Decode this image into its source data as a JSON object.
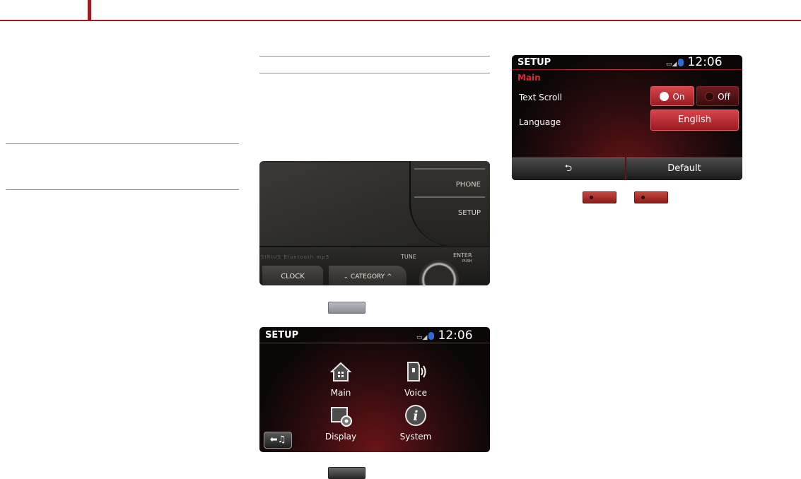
{
  "head_unit": {
    "phone_label": "PHONE",
    "setup_label": "SETUP",
    "tune_label": "TUNE",
    "enter_label": "ENTER",
    "push_label": "PUSH",
    "clock_label": "CLOCK",
    "category_label": "⌄ CATEGORY ^",
    "logos_text": "SIRIUS  Bluetooth  mp3"
  },
  "setup_menu": {
    "title": "SETUP",
    "time": "12:06",
    "items": [
      {
        "label": "Main",
        "icon": "home-icon"
      },
      {
        "label": "Voice",
        "icon": "voice-icon"
      },
      {
        "label": "Display",
        "icon": "display-settings-icon"
      },
      {
        "label": "System",
        "icon": "info-icon"
      }
    ],
    "back_icon": "back-music-icon"
  },
  "main_settings": {
    "title": "SETUP",
    "time": "12:06",
    "section": "Main",
    "rows": {
      "text_scroll_label": "Text Scroll",
      "on_label": "On",
      "off_label": "Off",
      "selected": "On",
      "language_label": "Language",
      "language_value": "English"
    },
    "bottom": {
      "back_icon": "return-icon",
      "default_label": "Default"
    }
  },
  "colors": {
    "accent": "#9b1b22",
    "screen_red": "#e0262f"
  }
}
